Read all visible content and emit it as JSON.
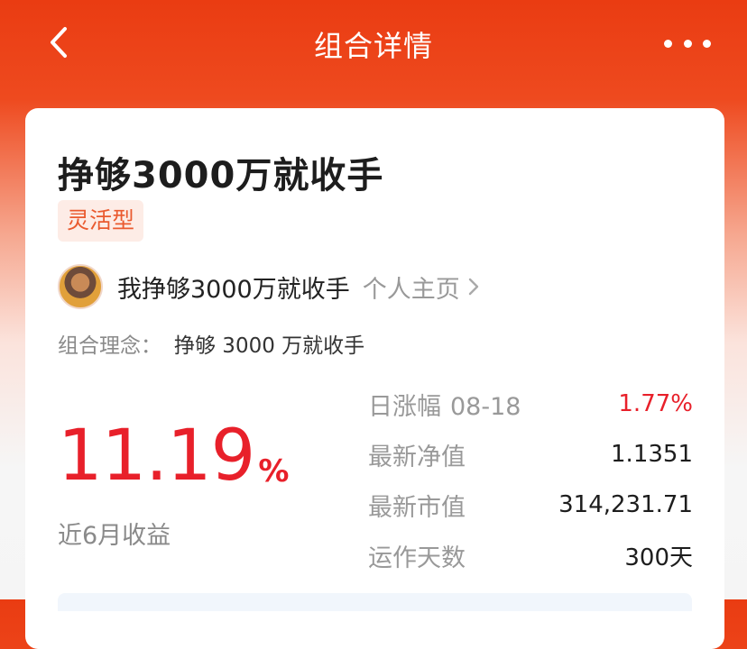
{
  "nav": {
    "title": "组合详情"
  },
  "portfolio": {
    "name": "挣够3000万就收手",
    "type_tag": "灵活型",
    "author": {
      "name": "我挣够3000万就收手",
      "homepage_label": "个人主页"
    },
    "philosophy": {
      "label": "组合理念：",
      "text": "挣够 3000 万就收手"
    },
    "return": {
      "value": "11.19",
      "unit": "%",
      "label": "近6月收益"
    },
    "stats": {
      "daily_change": {
        "label": "日涨幅",
        "date": "08-18",
        "value": "1.77%"
      },
      "latest_nav": {
        "label": "最新净值",
        "value": "1.1351"
      },
      "market_value": {
        "label": "最新市值",
        "value": "314,231.71"
      },
      "running_days": {
        "label": "运作天数",
        "value": "300天"
      }
    }
  },
  "colors": {
    "brand": "#ea3c12",
    "up": "#e8202a",
    "tag_text": "#ea5a2f",
    "tag_bg": "#fdece6"
  }
}
